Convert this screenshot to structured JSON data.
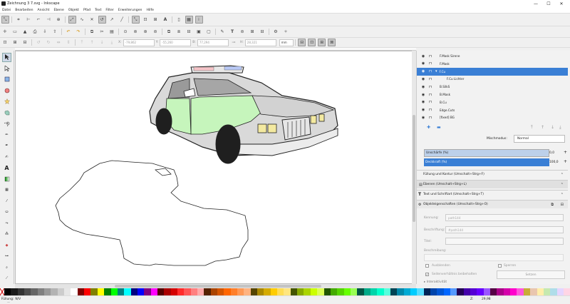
{
  "window": {
    "title": "Zeichnung 3 7.svg - Inkscape",
    "minimize": "—",
    "maximize": "☐",
    "close": "✕"
  },
  "menu": [
    "Datei",
    "Bearbeiten",
    "Ansicht",
    "Ebene",
    "Objekt",
    "Pfad",
    "Text",
    "Filter",
    "Erweiterungen",
    "Hilfe"
  ],
  "toolctrl": {
    "x_label": "X:",
    "x_value": "-79,862",
    "y_label": "Y:",
    "y_value": "-55,260",
    "w_label": "B:",
    "w_value": "77,294",
    "h_label": "H:",
    "h_value": "28,321",
    "unit": "mm"
  },
  "layers": [
    {
      "name": "F.Mask Sirene",
      "indent": 0,
      "selected": false
    },
    {
      "name": "F.Mask",
      "indent": 0,
      "selected": false
    },
    {
      "name": "F.Cu",
      "indent": 0,
      "selected": true,
      "expanded": true
    },
    {
      "name": "F.Cu Lichter",
      "indent": 1,
      "selected": false
    },
    {
      "name": "B.SilkS",
      "indent": 0,
      "selected": false
    },
    {
      "name": "B.Mask",
      "indent": 0,
      "selected": false
    },
    {
      "name": "B.Cu",
      "indent": 0,
      "selected": false
    },
    {
      "name": "Edge.Cuts",
      "indent": 0,
      "selected": false
    },
    {
      "name": "[fixed] BG",
      "indent": 0,
      "selected": false
    }
  ],
  "blend": {
    "label": "Mischmodus:",
    "value": "Normal"
  },
  "blur": {
    "label": "Unschärfe (%)",
    "value": "0,0"
  },
  "opacity": {
    "label": "Deckkraft (%)",
    "value": "100,0"
  },
  "panels": [
    {
      "title": "Füllung und Kontur (Umschalt+Strg+F)"
    },
    {
      "title": "Ebenen (Umschalt+Strg+L)"
    },
    {
      "title": "Text und Schriftart (Umschalt+Strg+T)"
    }
  ],
  "objprops": {
    "title": "Objekteigenschaften (Umschalt+Strg+O)",
    "id_label": "Kennung:",
    "id_value": "path144",
    "label_label": "Beschriftung:",
    "label_value": "#path144",
    "title_label": "Titel:",
    "desc_label": "Beschreibung:",
    "hide_label": "Ausblenden",
    "lock_label": "Sperren",
    "aspect_label": "Seitenverhältnis beibehalten",
    "set_button": "Setzen",
    "interactivity": "Interaktivität"
  },
  "status": {
    "fill_label": "Füllung:",
    "fill_value": "N/V",
    "zoom_label": "Z:",
    "zoom_value": "29,98"
  },
  "colors": {
    "accent": "#3a7fd5",
    "car_green": "#c6f5bc",
    "car_body": "#d9d9d9"
  },
  "palette": [
    "#000000",
    "#1a1a1a",
    "#333333",
    "#4d4d4d",
    "#666666",
    "#808080",
    "#999999",
    "#b3b3b3",
    "#cccccc",
    "#e6e6e6",
    "#ffffff",
    "#800000",
    "#ff0000",
    "#808000",
    "#ffff00",
    "#008000",
    "#00ff00",
    "#008080",
    "#00ffff",
    "#000080",
    "#0000ff",
    "#800080",
    "#ff00ff",
    "#550000",
    "#aa0000",
    "#d40000",
    "#ff2a2a",
    "#ff5555",
    "#ff8080",
    "#ffaaaa",
    "#552200",
    "#aa4400",
    "#d45500",
    "#ff6600",
    "#ff7f2a",
    "#ff9955",
    "#ffb380",
    "#554400",
    "#aa8800",
    "#d4aa00",
    "#ffcc00",
    "#ffdd55",
    "#ffe680",
    "#445500",
    "#88aa00",
    "#aad400",
    "#ccff00",
    "#ddff55",
    "#225500",
    "#44aa00",
    "#55d400",
    "#66ff00",
    "#99ff55",
    "#005544",
    "#00aa88",
    "#00d4aa",
    "#00ffcc",
    "#55ffdd",
    "#004455",
    "#0088aa",
    "#00aad4",
    "#00ccff",
    "#55ddff",
    "#002255",
    "#0044aa",
    "#0055d4",
    "#0066ff",
    "#5599ff",
    "#220055",
    "#4400aa",
    "#5500d4",
    "#6600ff",
    "#9955ff",
    "#550044",
    "#aa0088",
    "#d400aa",
    "#ff00cc",
    "#ff55dd",
    "#c8ab37",
    "#e9c6af",
    "#ffeeaa",
    "#c6e9af",
    "#afdde9",
    "#e5d5ff",
    "#ffd5e5"
  ]
}
